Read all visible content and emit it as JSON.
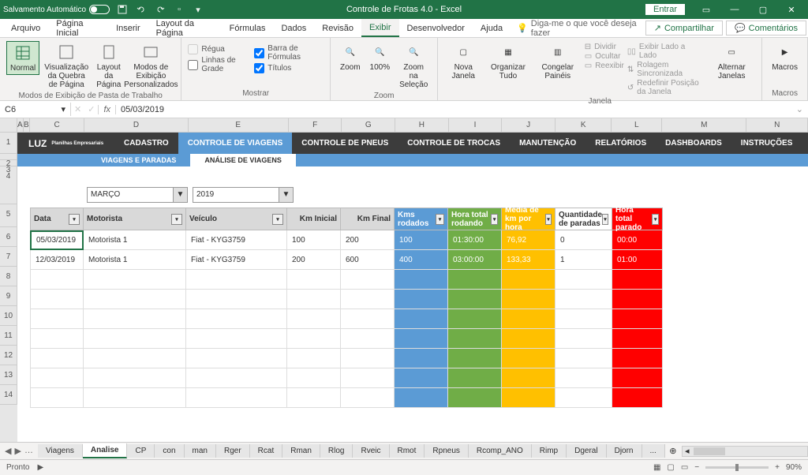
{
  "app": {
    "title": "Controle de Frotas 4.0  -  Excel",
    "autosave": "Salvamento Automático",
    "entrar": "Entrar"
  },
  "menu": {
    "arquivo": "Arquivo",
    "pagina": "Página Inicial",
    "inserir": "Inserir",
    "layout": "Layout da Página",
    "formulas": "Fórmulas",
    "dados": "Dados",
    "revisao": "Revisão",
    "exibir": "Exibir",
    "dev": "Desenvolvedor",
    "ajuda": "Ajuda",
    "tellme": "Diga-me o que você deseja fazer",
    "share": "Compartilhar",
    "comments": "Comentários"
  },
  "ribbon": {
    "view": {
      "normal": "Normal",
      "quebra": "Visualização da Quebra de Página",
      "layout": "Layout da Página",
      "modos": "Modos de Exibição Personalizados",
      "group1": "Modos de Exibição de Pasta de Trabalho"
    },
    "show": {
      "regua": "Régua",
      "grade": "Linhas de Grade",
      "barra": "Barra de Fórmulas",
      "titulos": "Títulos",
      "label": "Mostrar"
    },
    "zoom": {
      "zoom": "Zoom",
      "cem": "100%",
      "sel": "Zoom na Seleção",
      "label": "Zoom"
    },
    "window": {
      "nova": "Nova Janela",
      "org": "Organizar Tudo",
      "cong": "Congelar Painéis",
      "div": "Dividir",
      "ocultar": "Ocultar",
      "reex": "Reexibir",
      "lado": "Exibir Lado a Lado",
      "rolagem": "Rolagem Sincronizada",
      "redef": "Redefinir Posição da Janela",
      "alt": "Alternar Janelas",
      "label": "Janela"
    },
    "macros": {
      "macros": "Macros",
      "label": "Macros"
    }
  },
  "formula": {
    "ref": "C6",
    "val": "05/03/2019"
  },
  "cols": [
    "A",
    "B",
    "C",
    "D",
    "E",
    "F",
    "G",
    "H",
    "I",
    "J",
    "K",
    "L",
    "M",
    "N"
  ],
  "rows": [
    "1",
    "2",
    "3",
    "4",
    "5",
    "6",
    "7",
    "8",
    "9",
    "10",
    "11",
    "12",
    "13",
    "14"
  ],
  "nav": {
    "logo1": "LUZ",
    "logo2": "Planilhas Empresariais",
    "cadastro": "CADASTRO",
    "controle_v": "CONTROLE DE VIAGENS",
    "controle_p": "CONTROLE DE PNEUS",
    "controle_t": "CONTROLE DE TROCAS",
    "manut": "MANUTENÇÃO",
    "rel": "RELATÓRIOS",
    "dash": "DASHBOARDS",
    "inst": "INSTRUÇÕES"
  },
  "subnav": {
    "vp": "VIAGENS E PARADAS",
    "av": "ANÁLISE DE VIAGENS"
  },
  "filters": {
    "mes": "MARÇO",
    "ano": "2019"
  },
  "headers": {
    "data": "Data",
    "mot": "Motorista",
    "vei": "Veículo",
    "kmi": "Km Inicial",
    "kmf": "Km Final",
    "kms": "Kms rodados",
    "hr": "Hora total rodando",
    "med": "Média de km por hora",
    "qtd": "Quantidade de paradas",
    "hp": "Hora total parado"
  },
  "data_rows": [
    {
      "data": "05/03/2019",
      "mot": "Motorista 1",
      "vei": "Fiat - KYG3759",
      "kmi": "100",
      "kmf": "200",
      "kms": "100",
      "hr": "01:30:00",
      "med": "76,92",
      "qtd": "0",
      "hp": "00:00"
    },
    {
      "data": "12/03/2019",
      "mot": "Motorista 1",
      "vei": "Fiat - KYG3759",
      "kmi": "200",
      "kmf": "600",
      "kms": "400",
      "hr": "03:00:00",
      "med": "133,33",
      "qtd": "1",
      "hp": "01:00"
    }
  ],
  "sheets": {
    "viagens": "Viagens",
    "analise": "Analise",
    "cp": "CP",
    "con": "con",
    "man": "man",
    "rger": "Rger",
    "rcat": "Rcat",
    "rman": "Rman",
    "rlog": "Rlog",
    "rveic": "Rveic",
    "rmot": "Rmot",
    "rpneus": "Rpneus",
    "rano": "Rcomp_ANO",
    "rimp": "Rimp",
    "dgeral": "Dgeral",
    "djorn": "Djorn",
    "more": "..."
  },
  "status": {
    "ready": "Pronto",
    "zoom": "90%"
  }
}
